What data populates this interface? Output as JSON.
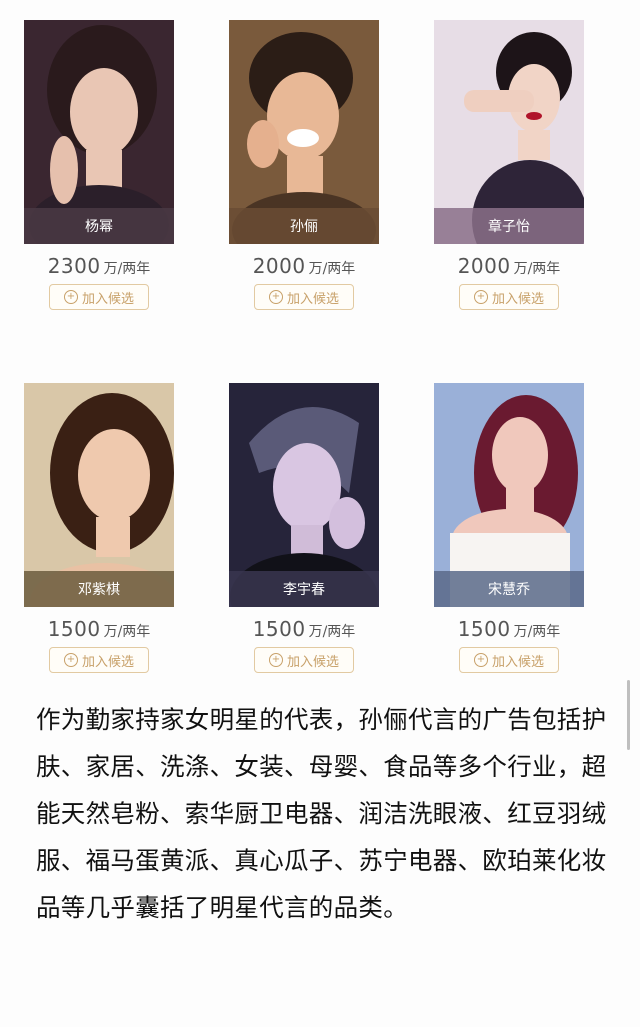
{
  "celebrities": [
    {
      "name": "杨幂",
      "price": "2300",
      "unit": "万/两年",
      "button": "加入候选",
      "colors": {
        "bg": "#3a2630",
        "skin": "#e9c6b4",
        "hair": "#2a1a1c",
        "bar": "#4a3a44"
      }
    },
    {
      "name": "孙俪",
      "price": "2000",
      "unit": "万/两年",
      "button": "加入候选",
      "colors": {
        "bg": "#7a5a3c",
        "skin": "#e8b896",
        "hair": "#2b1d16",
        "bar": "#6a4c34"
      }
    },
    {
      "name": "章子怡",
      "price": "2000",
      "unit": "万/两年",
      "button": "加入候选",
      "colors": {
        "bg": "#e7dde6",
        "skin": "#f1d4c6",
        "hair": "#1d1418",
        "bar": "#8a7088"
      }
    },
    {
      "name": "邓紫棋",
      "price": "1500",
      "unit": "万/两年",
      "button": "加入候选",
      "colors": {
        "bg": "#d9c7a8",
        "skin": "#efc9ae",
        "hair": "#3a2014",
        "bar": "#6b5c3e"
      }
    },
    {
      "name": "李宇春",
      "price": "1500",
      "unit": "万/两年",
      "button": "加入候选",
      "colors": {
        "bg": "#26243a",
        "skin": "#d9c6e2",
        "hair": "#5a5a78",
        "bar": "#3a3650"
      }
    },
    {
      "name": "宋慧乔",
      "price": "1500",
      "unit": "万/两年",
      "button": "加入候选",
      "colors": {
        "bg": "#9ab0d8",
        "skin": "#f0c8bc",
        "hair": "#6a1a30",
        "bar": "#5a6a8a"
      }
    }
  ],
  "article": {
    "text": "作为勤家持家女明星的代表，孙俪代言的广告包括护肤、家居、洗涤、女装、母婴、食品等多个行业，超能天然皂粉、索华厨卫电器、润洁洗眼液、红豆羽绒服、福马蛋黄派、真心瓜子、苏宁电器、欧珀莱化妆品等几乎囊括了明星代言的品类。"
  },
  "icons": {
    "add": "plus-circle-icon"
  }
}
